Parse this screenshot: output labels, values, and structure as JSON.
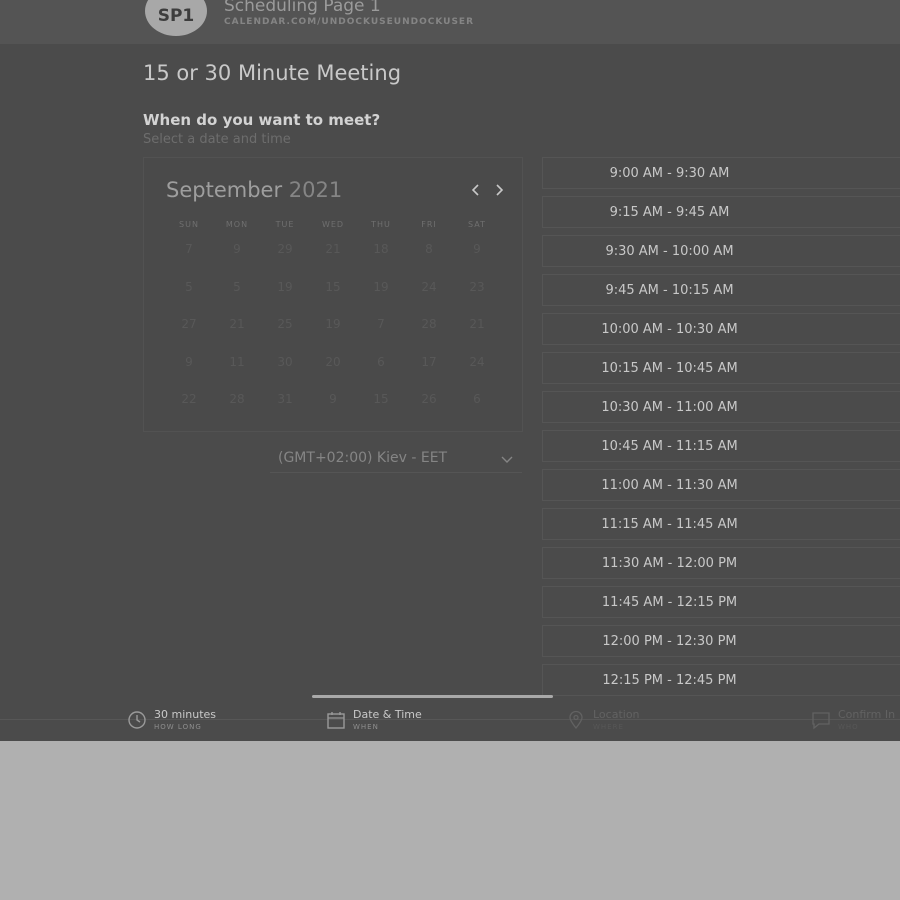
{
  "header": {
    "avatar_initials": "SP1",
    "page_name": "Scheduling Page 1",
    "page_url": "CALENDAR.COM/UNDOCKUSEUNDOCKUSER"
  },
  "event_title": "15 or 30 Minute Meeting",
  "question": "When do you want to meet?",
  "hint": "Select a date and time",
  "calendar": {
    "month": "September",
    "year": "2021",
    "weekdays": [
      "SUN",
      "MON",
      "TUE",
      "WED",
      "THU",
      "FRI",
      "SAT"
    ],
    "days": [
      [
        "7",
        "9",
        "29",
        "21",
        "18",
        "8",
        "9"
      ],
      [
        "5",
        "5",
        "19",
        "15",
        "19",
        "24",
        "23"
      ],
      [
        "27",
        "21",
        "25",
        "19",
        "7",
        "28",
        "21"
      ],
      [
        "9",
        "11",
        "30",
        "20",
        "6",
        "17",
        "24"
      ],
      [
        "22",
        "28",
        "31",
        "9",
        "15",
        "26",
        "6"
      ]
    ]
  },
  "timezone": "(GMT+02:00) Kiev - EET",
  "slots": [
    "9:00 AM - 9:30 AM",
    "9:15 AM - 9:45 AM",
    "9:30 AM - 10:00 AM",
    "9:45 AM - 10:15 AM",
    "10:00 AM - 10:30 AM",
    "10:15 AM - 10:45 AM",
    "10:30 AM - 11:00 AM",
    "10:45 AM - 11:15 AM",
    "11:00 AM - 11:30 AM",
    "11:15 AM - 11:45 AM",
    "11:30 AM - 12:00 PM",
    "11:45 AM - 12:15 PM",
    "12:00 PM - 12:30 PM",
    "12:15 PM - 12:45 PM"
  ],
  "steps": {
    "duration": {
      "title": "30 minutes",
      "sub": "HOW LONG",
      "icon": "clock-icon"
    },
    "datetime": {
      "title": "Date & Time",
      "sub": "WHEN",
      "icon": "calendar-icon"
    },
    "location": {
      "title": "Location",
      "sub": "WHERE",
      "icon": "map-pin-icon"
    },
    "confirm": {
      "title": "Confirm In",
      "sub": "WHO",
      "icon": "message-icon"
    }
  }
}
